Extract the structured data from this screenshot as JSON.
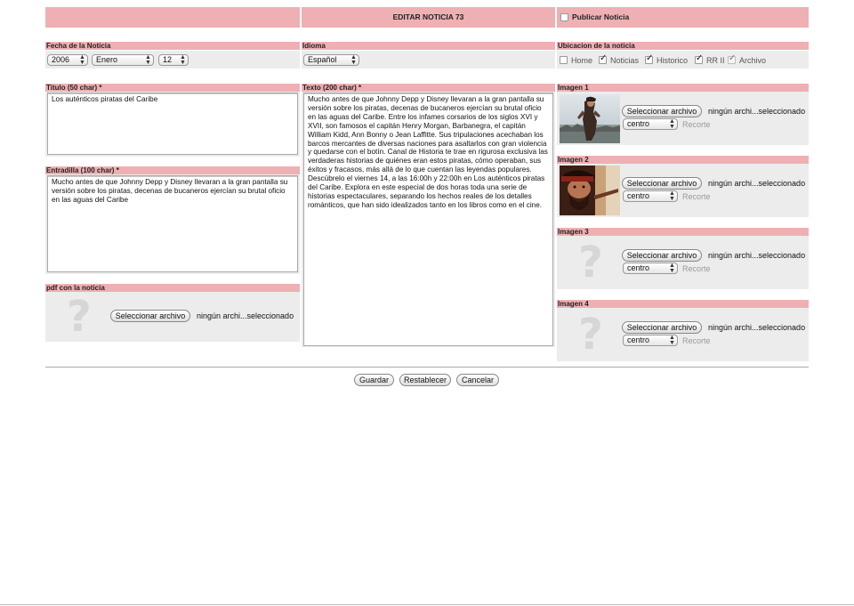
{
  "header": {
    "title": "EDITAR NOTICIA 73",
    "publish_label": "Publicar Noticia"
  },
  "fecha": {
    "label": "Fecha de la Noticia",
    "year": "2006",
    "month": "Enero",
    "day": "12"
  },
  "idioma": {
    "label": "Idioma",
    "value": "Español"
  },
  "ubicacion": {
    "label": "Ubicacion de la noticia",
    "options": [
      {
        "label": "Home",
        "checked": false
      },
      {
        "label": "Noticias",
        "checked": true
      },
      {
        "label": "Historico",
        "checked": true
      },
      {
        "label": "RR II",
        "checked": true
      },
      {
        "label": "Archivo",
        "checked": true
      }
    ]
  },
  "titulo": {
    "label": "Titulo (50 char) *",
    "value": "Los auténticos piratas del Caribe"
  },
  "entradilla": {
    "label": "Entradilla (100 char) *",
    "value": "Mucho antes de que Johnny Depp y Disney llevaran a la gran pantalla su versión sobre los piratas, decenas de bucaneros ejercían su brutal oficio en las aguas del Caribe"
  },
  "pdf": {
    "label": "pdf con la noticia",
    "button": "Seleccionar archivo",
    "status": "ningún archi...seleccionado"
  },
  "texto": {
    "label": "Texto (200 char) *",
    "value": "Mucho antes de que Johnny Depp y Disney llevaran a la gran pantalla su versión sobre los piratas, decenas de bucaneros ejercían su brutal oficio en las aguas del Caribe. Entre los infames corsarios de los siglos XVI y XVII, son famosos el capitán Henry Morgan, Barbanegra, el capitán William Kidd, Ann Bonny o Jean Laffitte. Sus tripulaciones acechaban los barcos mercantes de diversas naciones para asaltarlos con gran violencia y quedarse con el botín. Canal de Historia te trae en rigurosa exclusiva las verdaderas historias de quiénes eran estos piratas, cómo operaban, sus éxitos y fracasos, más allá de lo que cuentan las leyendas populares. Descúbrelo el viernes 14, a las 16:00h y 22:00h en Los auténticos piratas del Caribe. Explora en este especial de dos horas toda una serie de historias espectaculares, separando los hechos reales de los detalles románticos, que han sido idealizados tanto en los libros como en el cine."
  },
  "imagenes": [
    {
      "label": "Imagen 1",
      "button": "Seleccionar archivo",
      "status": "ningún archi...seleccionado",
      "position": "centro",
      "recorte": "Recorte"
    },
    {
      "label": "Imagen 2",
      "button": "Seleccionar archivo",
      "status": "ningún archi...seleccionado",
      "position": "centro",
      "recorte": "Recorte"
    },
    {
      "label": "Imagen 3",
      "button": "Seleccionar archivo",
      "status": "ningún archi...seleccionado",
      "position": "centro",
      "recorte": "Recorte"
    },
    {
      "label": "Imagen 4",
      "button": "Seleccionar archivo",
      "status": "ningún archi...seleccionado",
      "position": "centro",
      "recorte": "Recorte"
    }
  ],
  "actions": {
    "save": "Guardar",
    "reset": "Restablecer",
    "cancel": "Cancelar"
  }
}
